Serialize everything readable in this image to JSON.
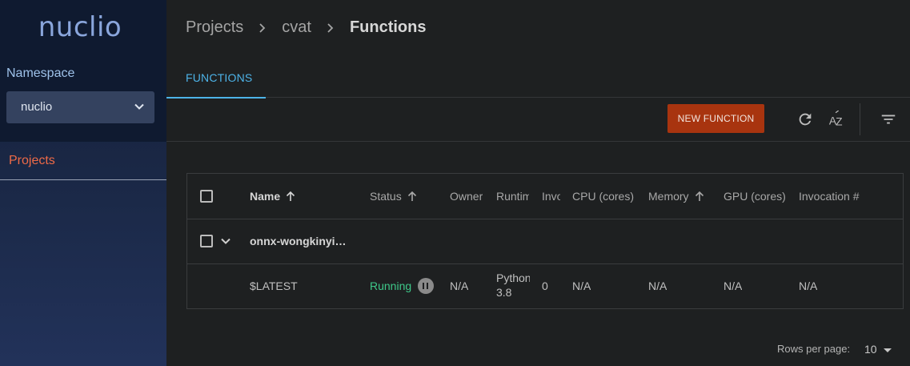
{
  "sidebar": {
    "logo": "nuclio",
    "namespace_label": "Namespace",
    "namespace_value": "nuclio",
    "items": [
      {
        "label": "Projects",
        "active": true
      }
    ]
  },
  "breadcrumb": [
    "Projects",
    "cvat",
    "Functions"
  ],
  "tabs": [
    {
      "label": "FUNCTIONS",
      "active": true
    }
  ],
  "toolbar": {
    "new_function_label": "NEW FUNCTION",
    "icons": [
      "refresh-icon",
      "sort-az-icon",
      "filter-icon"
    ]
  },
  "table": {
    "headers": {
      "name": "Name",
      "status": "Status",
      "owner": "Owner",
      "runtime": "Runtime",
      "invocations": "Invocations",
      "cpu": "CPU (cores)",
      "memory": "Memory",
      "gpu": "GPU (cores)",
      "invocation_num": "Invocation #"
    },
    "group_name": "onnx-wongkinyi…",
    "rows": [
      {
        "name": "$LATEST",
        "status": "Running",
        "owner": "N/A",
        "runtime_line1": "Python",
        "runtime_line2": "3.8",
        "invocations": "0",
        "cpu": "N/A",
        "memory": "N/A",
        "gpu": "N/A",
        "invocation_num": "N/A"
      }
    ]
  },
  "pagination": {
    "rows_per_page_label": "Rows per page:",
    "rows_per_page_value": "10"
  },
  "colors": {
    "accent_blue": "#4db3e8",
    "brand_orange": "#a8340f",
    "running_green": "#3ec98a",
    "nav_active": "#ee6a47"
  }
}
